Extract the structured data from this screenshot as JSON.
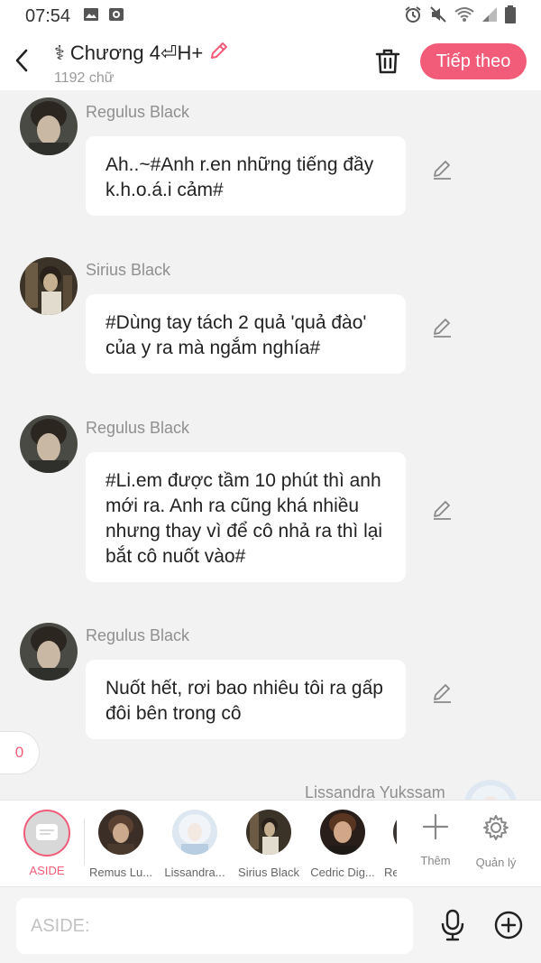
{
  "status": {
    "time": "07:54",
    "icons": [
      "image-icon",
      "camera-icon",
      "alarm-icon",
      "mute-icon",
      "wifi-icon",
      "signal-icon",
      "battery-icon"
    ]
  },
  "header": {
    "cross_symbol": "⚕",
    "title": "Chương 4",
    "title_suffix": "⏎H+",
    "word_count": "1192 chữ",
    "next_label": "Tiếp theo",
    "accent": "#f25c79"
  },
  "messages": [
    {
      "sender": "Regulus Black",
      "text": "Ah..~#Anh r.en những tiếng đầy k.h.o.á.i cảm#"
    },
    {
      "sender": "Sirius Black",
      "text": "#Dùng tay tách 2 quả 'quả đào' của y ra mà ngắm nghía#"
    },
    {
      "sender": "Regulus Black",
      "text": "#Li.em được tầm 10 phút thì anh mới ra. Anh ra cũng khá nhiều nhưng thay vì để cô nhả ra thì lại bắt cô nuốt vào#"
    },
    {
      "sender": "Regulus Black",
      "text": "Nuốt hết, rơi bao nhiêu tôi ra gấp đôi bên trong cô"
    }
  ],
  "unread_badge": "0",
  "partial_sender": "Lissandra Yukssam",
  "characters": {
    "aside_label": "ASIDE",
    "list": [
      "Remus Lu...",
      "Lissandra...",
      "Sirius Black",
      "Cedric Dig...",
      "Re"
    ],
    "more_label": "Thêm",
    "manage_label": "Quản lý"
  },
  "input": {
    "placeholder": "ASIDE:"
  }
}
